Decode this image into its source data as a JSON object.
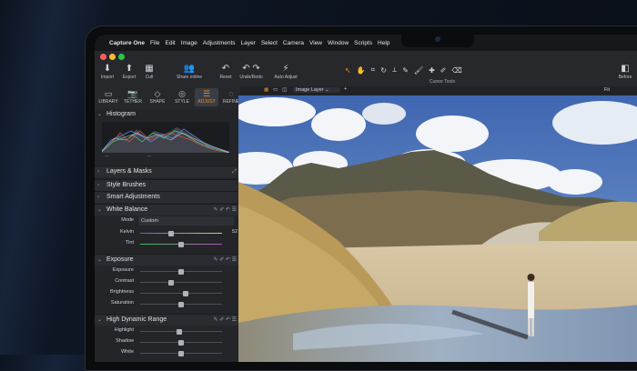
{
  "menubar": {
    "app_name": "Capture One",
    "items": [
      "File",
      "Edit",
      "Image",
      "Adjustments",
      "Layer",
      "Select",
      "Camera",
      "View",
      "Window",
      "Scripts",
      "Help"
    ]
  },
  "toolbar": {
    "buttons": [
      {
        "label": "Import",
        "icon": "import-icon"
      },
      {
        "label": "Export",
        "icon": "export-icon"
      },
      {
        "label": "Cull",
        "icon": "cull-icon"
      },
      {
        "label": "Share online",
        "icon": "share-online-icon"
      },
      {
        "label": "Reset",
        "icon": "reset-icon"
      },
      {
        "label": "Undo/Redo",
        "icon": "undo-redo-icon"
      },
      {
        "label": "Auto Adjust",
        "icon": "auto-adjust-icon"
      }
    ],
    "cursor_tools_label": "Cursor Tools",
    "before_label": "Before"
  },
  "tabs": [
    {
      "label": "LIBRARY",
      "icon": "library-icon"
    },
    {
      "label": "TETHER",
      "icon": "tether-icon"
    },
    {
      "label": "SHAPE",
      "icon": "shape-icon"
    },
    {
      "label": "STYLE",
      "icon": "style-icon"
    },
    {
      "label": "ADJUST",
      "icon": "adjust-icon"
    },
    {
      "label": "REFINE",
      "icon": "refine-icon"
    }
  ],
  "viewer": {
    "layer_select": "Image Layer",
    "fit_label": "Fit"
  },
  "panel": {
    "histogram": {
      "title": "Histogram",
      "markers": [
        "--",
        "--"
      ]
    },
    "layers_masks": "Layers & Masks",
    "style_brushes": "Style Brushes",
    "smart_adjustments": "Smart Adjustments",
    "white_balance": {
      "title": "White Balance",
      "mode_label": "Mode",
      "mode_value": "Custom",
      "kelvin_label": "Kelvin",
      "kelvin_value": "52",
      "tint_label": "Tint",
      "kelvin_level": 0.38,
      "tint_level": 0.5
    },
    "exposure": {
      "title": "Exposure",
      "rows": [
        {
          "label": "Exposure",
          "level": 0.5
        },
        {
          "label": "Contrast",
          "level": 0.38
        },
        {
          "label": "Brightness",
          "level": 0.55
        },
        {
          "label": "Saturation",
          "level": 0.5
        }
      ]
    },
    "hdr": {
      "title": "High Dynamic Range",
      "rows": [
        {
          "label": "Highlight",
          "level": 0.48
        },
        {
          "label": "Shadow",
          "level": 0.5
        },
        {
          "label": "White",
          "level": 0.5
        }
      ]
    }
  }
}
